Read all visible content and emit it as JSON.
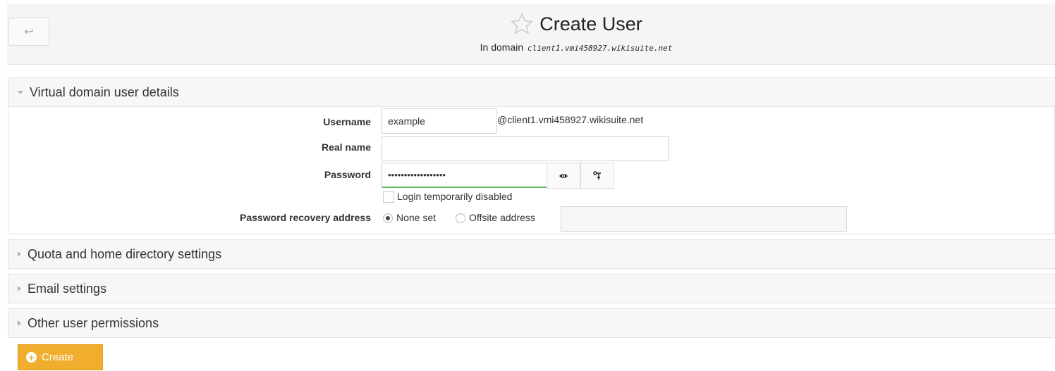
{
  "header": {
    "back_icon": "↩",
    "title": "Create User",
    "subtitle_prefix": "In domain",
    "domain": "client1.vmi458927.wikisuite.net"
  },
  "sections": [
    {
      "label": "Virtual domain user details",
      "expanded": true
    },
    {
      "label": "Quota and home directory settings",
      "expanded": false
    },
    {
      "label": "Email settings",
      "expanded": false
    },
    {
      "label": "Other user permissions",
      "expanded": false
    }
  ],
  "form": {
    "username_label": "Username",
    "username_value": "example",
    "username_suffix": "@client1.vmi458927.wikisuite.net",
    "realname_label": "Real name",
    "realname_value": "",
    "password_label": "Password",
    "password_value": "••••••••••••••••••",
    "login_disabled_label": "Login temporarily disabled",
    "recovery_label": "Password recovery address",
    "recovery_options": [
      "None set",
      "Offsite address"
    ],
    "recovery_selected": "None set",
    "offsite_value": ""
  },
  "actions": {
    "create_label": "Create"
  },
  "colors": {
    "accent": "#f0ad2e",
    "password_strength": "#5cb85c"
  }
}
